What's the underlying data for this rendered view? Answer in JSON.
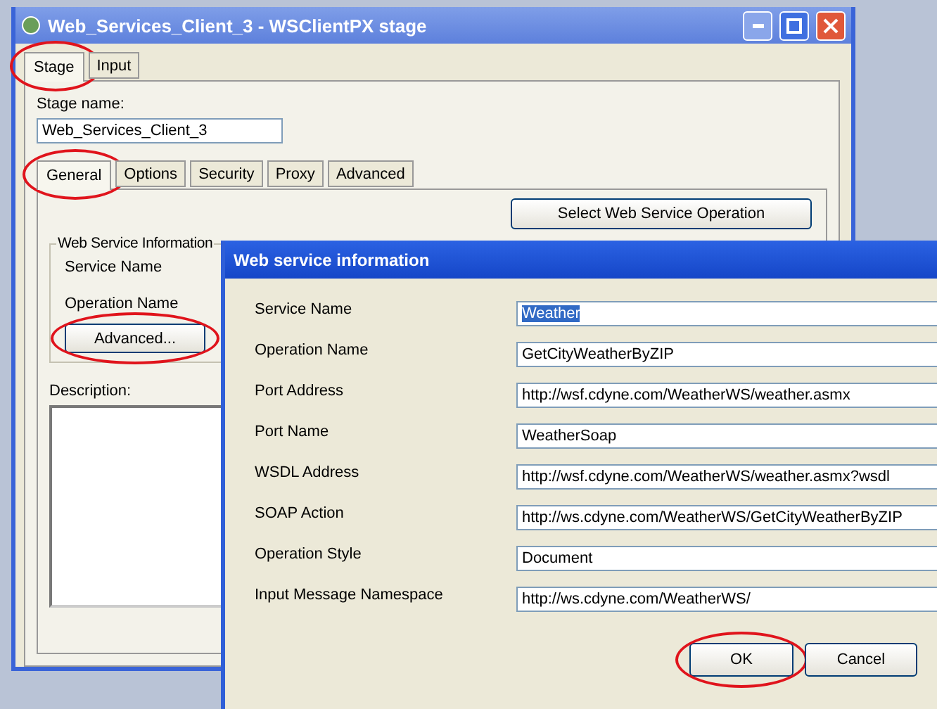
{
  "main_window": {
    "title": "Web_Services_Client_3 - WSClientPX stage",
    "tabs": [
      {
        "label": "Stage",
        "selected": true,
        "highlighted": true
      },
      {
        "label": "Input",
        "selected": false,
        "highlighted": false
      }
    ],
    "stage_name": {
      "label": "Stage name:",
      "value": "Web_Services_Client_3"
    },
    "sub_tabs": [
      {
        "label": "General",
        "selected": true,
        "highlighted": true
      },
      {
        "label": "Options",
        "selected": false,
        "highlighted": false
      },
      {
        "label": "Security",
        "selected": false,
        "highlighted": false
      },
      {
        "label": "Proxy",
        "selected": false,
        "highlighted": false
      },
      {
        "label": "Advanced",
        "selected": false,
        "highlighted": false
      }
    ],
    "select_button": "Select Web Service Operation",
    "group": {
      "title": "Web Service Information",
      "labels": [
        "Service Name",
        "Operation Name"
      ],
      "button": {
        "label": "Advanced...",
        "highlighted": true
      }
    },
    "description_label": "Description:"
  },
  "dialog": {
    "title": "Web service information",
    "fields": [
      {
        "label": "Service Name",
        "value": "Weather",
        "text_selected": true
      },
      {
        "label": "Operation Name",
        "value": "GetCityWeatherByZIP",
        "text_selected": false
      },
      {
        "label": "Port Address",
        "value": "http://wsf.cdyne.com/WeatherWS/weather.asmx",
        "text_selected": false
      },
      {
        "label": "Port Name",
        "value": "WeatherSoap",
        "text_selected": false
      },
      {
        "label": "WSDL Address",
        "value": "http://wsf.cdyne.com/WeatherWS/weather.asmx?wsdl",
        "text_selected": false
      },
      {
        "label": "SOAP Action",
        "value": "http://ws.cdyne.com/WeatherWS/GetCityWeatherByZIP",
        "text_selected": false
      },
      {
        "label": "Operation Style",
        "value": "Document",
        "text_selected": false
      },
      {
        "label": "Input Message Namespace",
        "value": "http://ws.cdyne.com/WeatherWS/",
        "text_selected": false
      }
    ],
    "buttons": [
      {
        "label": "OK",
        "highlighted": true
      },
      {
        "label": "Cancel",
        "highlighted": false
      }
    ]
  }
}
